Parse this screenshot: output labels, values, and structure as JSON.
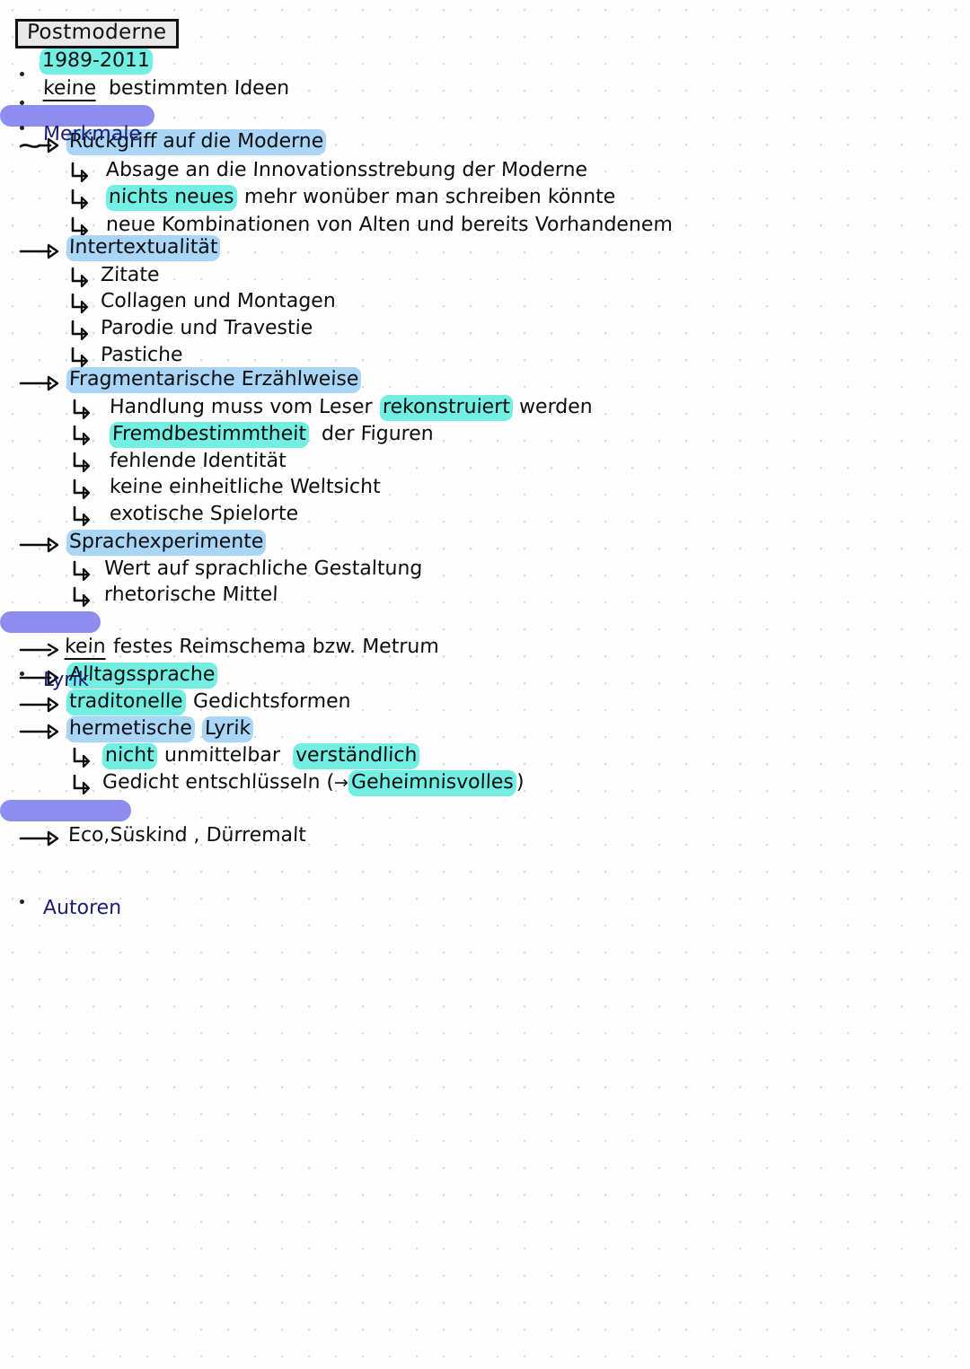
{
  "document": {
    "title": "Postmoderne",
    "type": "handwritten-study-notes",
    "subject": "German literature — Postmodernism",
    "colors": {
      "highlight_cyan": "#72eee3",
      "highlight_blue": "#a9d6f7",
      "highlight_purple": "#8d8df0",
      "ink": "#0d0d0d",
      "paper": "#fefefe",
      "grid_dot": "#d8d8de"
    }
  },
  "markers": {
    "dot": "•",
    "arrow": "→",
    "sub_arrow": "↳"
  },
  "lines": {
    "l1": "1989-2011",
    "l2_a": "keine",
    "l2_b": "bestimmten Ideen",
    "l3": "Merkmale",
    "l4": "Rückgriff auf die Moderne",
    "l5": "Absage an die Innovationsstrebung der Moderne",
    "l6_a": "nichts neues",
    "l6_b": "mehr wonüber man   schreiben könnte",
    "l7": "neue Kombinationen von Alten und bereits Vorhandenem",
    "l8": "Intertextualität",
    "l9": "Zitate",
    "l10": "Collagen und  Montagen",
    "l11": "Parodie und Travestie",
    "l12": "Pastiche",
    "l13": "Fragmentarische  Erzählweise",
    "l14_a": "Handlung muss vom Leser",
    "l14_b": "rekonstruiert",
    "l14_c": "werden",
    "l15_a": "Fremdbestimmtheit",
    "l15_b": "der  Figuren",
    "l16": "fehlende Identität",
    "l17": "keine einheitliche Weltsicht",
    "l18": "exotische Spielorte",
    "l19": "Sprachexperimente",
    "l20": "Wert auf sprachliche Gestaltung",
    "l21": "rhetorische Mittel",
    "l22": "Lyrik",
    "l23_a": "kein",
    "l23_b": "festes Reimschema bzw. Metrum",
    "l24": "Alltagssprache",
    "l25_a": "traditonelle",
    "l25_b": "Gedichtsformen",
    "l26_a": "hermetische",
    "l26_b": "Lyrik",
    "l27_a": "nicht",
    "l27_b": "unmittelbar",
    "l27_c": "verständlich",
    "l28_a": "Gedicht entschlüsseln (",
    "l28_b": "→",
    "l28_c": "Geheimnisvolles",
    "l28_d": ")",
    "l29": "Autoren",
    "l30": "Eco,Süskind , Dürremalt"
  }
}
